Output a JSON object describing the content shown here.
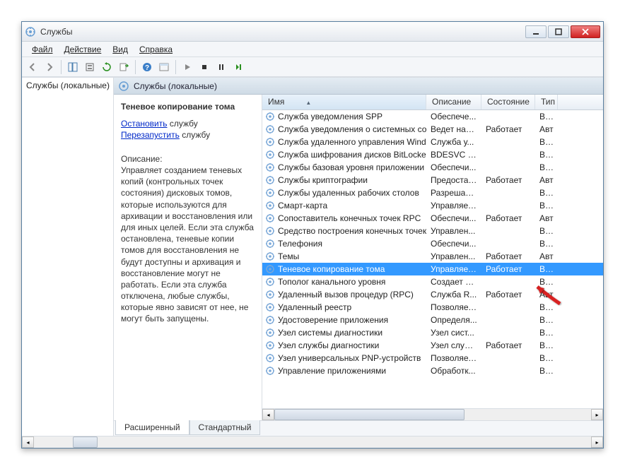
{
  "title": "Службы",
  "menu": {
    "file": "Файл",
    "action": "Действие",
    "view": "Вид",
    "help": "Справка"
  },
  "tree": {
    "root": "Службы (локальные)"
  },
  "panel_title": "Службы (локальные)",
  "details": {
    "name": "Теневое копирование тома",
    "stop_link": "Остановить",
    "stop_suffix": " службу",
    "restart_link": "Перезапустить",
    "restart_suffix": " службу",
    "desc_label": "Описание:",
    "desc": "Управляет созданием теневых копий (контрольных точек состояния) дисковых томов, которые используются для архивации и восстановления или для иных целей. Если эта служба остановлена, теневые копии томов для восстановления не будут доступны и архивация и восстановление могут не работать. Если эта служба отключена, любые службы, которые явно зависят от нее, не могут быть запущены."
  },
  "columns": {
    "name": "Имя",
    "desc": "Описание",
    "state": "Состояние",
    "type": "Тип"
  },
  "rows": [
    {
      "name": "Служба уведомления SPP",
      "desc": "Обеспече...",
      "state": "",
      "type": "Вру"
    },
    {
      "name": "Служба уведомления о системных соб...",
      "desc": "Ведет наб...",
      "state": "Работает",
      "type": "Авт"
    },
    {
      "name": "Служба удаленного управления Windo...",
      "desc": "Служба у...",
      "state": "",
      "type": "Вру"
    },
    {
      "name": "Служба шифрования дисков BitLocker",
      "desc": "BDESVC пр...",
      "state": "",
      "type": "Вру"
    },
    {
      "name": "Службы базовая уровня приложении",
      "desc": "Обеспечи...",
      "state": "",
      "type": "Вру"
    },
    {
      "name": "Службы криптографии",
      "desc": "Предостав...",
      "state": "Работает",
      "type": "Авт"
    },
    {
      "name": "Службы удаленных рабочих столов",
      "desc": "Разрешает...",
      "state": "",
      "type": "Вру"
    },
    {
      "name": "Смарт-карта",
      "desc": "Управляет...",
      "state": "",
      "type": "Вру"
    },
    {
      "name": "Сопоставитель конечных точек RPC",
      "desc": "Обеспечи...",
      "state": "Работает",
      "type": "Авт"
    },
    {
      "name": "Средство построения конечных точек ...",
      "desc": "Управлен...",
      "state": "",
      "type": "Вру"
    },
    {
      "name": "Телефония",
      "desc": "Обеспечи...",
      "state": "",
      "type": "Вру"
    },
    {
      "name": "Темы",
      "desc": "Управлен...",
      "state": "Работает",
      "type": "Авт"
    },
    {
      "name": "Теневое копирование тома",
      "desc": "Управляет...",
      "state": "Работает",
      "type": "Вру",
      "selected": true
    },
    {
      "name": "Тополог канального уровня",
      "desc": "Создает ка...",
      "state": "",
      "type": "Вру"
    },
    {
      "name": "Удаленный вызов процедур (RPC)",
      "desc": "Служба R...",
      "state": "Работает",
      "type": "Авт"
    },
    {
      "name": "Удаленный реестр",
      "desc": "Позволяет...",
      "state": "",
      "type": "Вру"
    },
    {
      "name": "Удостоверение приложения",
      "desc": "Определя...",
      "state": "",
      "type": "Вру"
    },
    {
      "name": "Узел системы диагностики",
      "desc": "Узел сист...",
      "state": "",
      "type": "Вру"
    },
    {
      "name": "Узел службы диагностики",
      "desc": "Узел служ...",
      "state": "Работает",
      "type": "Вру"
    },
    {
      "name": "Узел универсальных PNP-устройств",
      "desc": "Позволяет...",
      "state": "",
      "type": "Вру"
    },
    {
      "name": "Управление приложениями",
      "desc": "Обработк...",
      "state": "",
      "type": "Вру"
    }
  ],
  "tabs": {
    "extended": "Расширенный",
    "standard": "Стандартный"
  }
}
